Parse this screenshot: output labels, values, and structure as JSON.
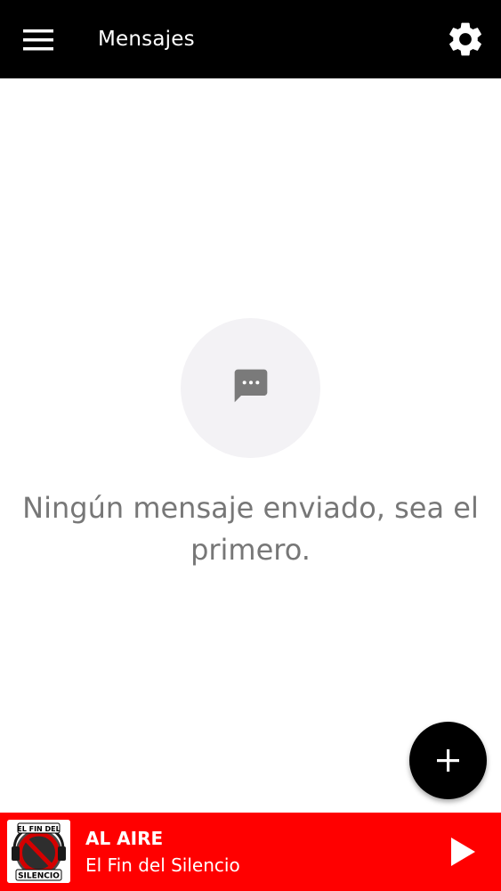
{
  "app_bar": {
    "title": "Mensajes",
    "menu_icon": "hamburger-menu-icon",
    "settings_icon": "gear-icon",
    "background": "#000000"
  },
  "empty_state": {
    "icon": "chat-bubble-icon",
    "message": "Ningún mensaje enviado, sea el primero."
  },
  "fab": {
    "icon": "plus-icon",
    "color": "#000000"
  },
  "player": {
    "status_label": "AL AIRE",
    "station_name": "El Fin del Silencio",
    "logo_text_top": "EL FIN DEL",
    "logo_text_bottom": "SILENCIO",
    "play_icon": "play-icon",
    "background": "#ff0000"
  }
}
